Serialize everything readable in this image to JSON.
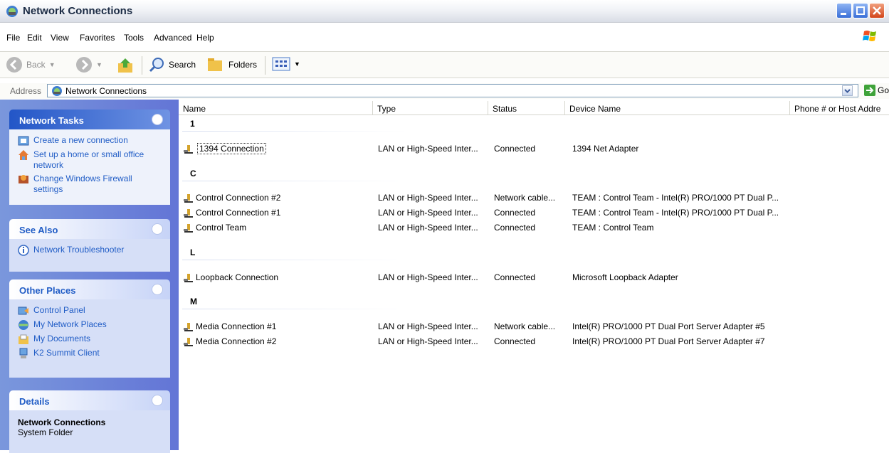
{
  "window": {
    "title": "Network Connections"
  },
  "menu": [
    "File",
    "Edit",
    "View",
    "Favorites",
    "Tools",
    "Advanced",
    "Help"
  ],
  "toolbar": {
    "back_label": "Back",
    "search_label": "Search",
    "folders_label": "Folders"
  },
  "address": {
    "label": "Address",
    "value": "Network Connections",
    "go_label": "Go"
  },
  "left_panel": {
    "network_tasks": {
      "title": "Network Tasks",
      "items": [
        "Create a new connection",
        "Set up a home or small office network",
        "Change Windows Firewall settings"
      ]
    },
    "see_also": {
      "title": "See Also",
      "items": [
        "Network Troubleshooter"
      ]
    },
    "other_places": {
      "title": "Other Places",
      "items": [
        "Control Panel",
        "My Network Places",
        "My Documents",
        "K2 Summit Client"
      ]
    },
    "details": {
      "title": "Details",
      "name": "Network Connections",
      "type": "System Folder"
    }
  },
  "list": {
    "columns": [
      "Name",
      "Type",
      "Status",
      "Device Name",
      "Phone # or Host Addre"
    ],
    "groups": [
      {
        "label": "1",
        "rows": [
          {
            "name": "1394 Connection",
            "type": "LAN or High-Speed Inter...",
            "status": "Connected",
            "device": "1394 Net Adapter"
          }
        ]
      },
      {
        "label": "C",
        "rows": [
          {
            "name": "Control Connection #2",
            "type": "LAN or High-Speed Inter...",
            "status": "Network cable...",
            "device": "TEAM : Control Team - Intel(R) PRO/1000 PT Dual P..."
          },
          {
            "name": "Control Connection #1",
            "type": "LAN or High-Speed Inter...",
            "status": "Connected",
            "device": "TEAM : Control Team - Intel(R) PRO/1000 PT Dual P..."
          },
          {
            "name": "Control Team",
            "type": "LAN or High-Speed Inter...",
            "status": "Connected",
            "device": "TEAM : Control Team"
          }
        ]
      },
      {
        "label": "L",
        "rows": [
          {
            "name": "Loopback Connection",
            "type": "LAN or High-Speed Inter...",
            "status": "Connected",
            "device": "Microsoft Loopback Adapter"
          }
        ]
      },
      {
        "label": "M",
        "rows": [
          {
            "name": "Media Connection #1",
            "type": "LAN or High-Speed Inter...",
            "status": "Network cable...",
            "device": "Intel(R) PRO/1000 PT Dual Port Server Adapter #5"
          },
          {
            "name": "Media Connection #2",
            "type": "LAN or High-Speed Inter...",
            "status": "Connected",
            "device": "Intel(R) PRO/1000 PT Dual Port Server Adapter #7"
          }
        ]
      }
    ]
  }
}
